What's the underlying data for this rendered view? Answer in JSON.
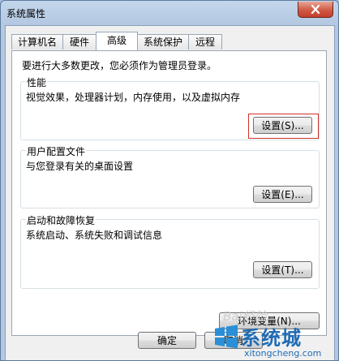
{
  "window": {
    "title": "系统属性",
    "close_icon": "close-icon"
  },
  "tabs": [
    {
      "label": "计算机名",
      "active": false
    },
    {
      "label": "硬件",
      "active": false
    },
    {
      "label": "高级",
      "active": true
    },
    {
      "label": "系统保护",
      "active": false
    },
    {
      "label": "远程",
      "active": false
    }
  ],
  "advanced": {
    "admin_notice": "要进行大多数更改，您必须作为管理员登录。",
    "performance": {
      "title": "性能",
      "description": "视觉效果，处理器计划，内存使用，以及虚拟内存",
      "button": "设置(S)..."
    },
    "user_profiles": {
      "title": "用户配置文件",
      "description": "与您登录有关的桌面设置",
      "button": "设置(E)..."
    },
    "startup_recovery": {
      "title": "启动和故障恢复",
      "description": "系统启动、系统失败和调试信息",
      "button": "设置(T)..."
    },
    "env_button": "环境变量(N)..."
  },
  "footer": {
    "ok": "确定",
    "cancel": "取消"
  },
  "watermark": {
    "brand": "系统城",
    "url": "xitongcheng.com",
    "faint": "Bai经验"
  },
  "colors": {
    "highlight": "#d0302a",
    "watermark": "#1f6bb5"
  }
}
